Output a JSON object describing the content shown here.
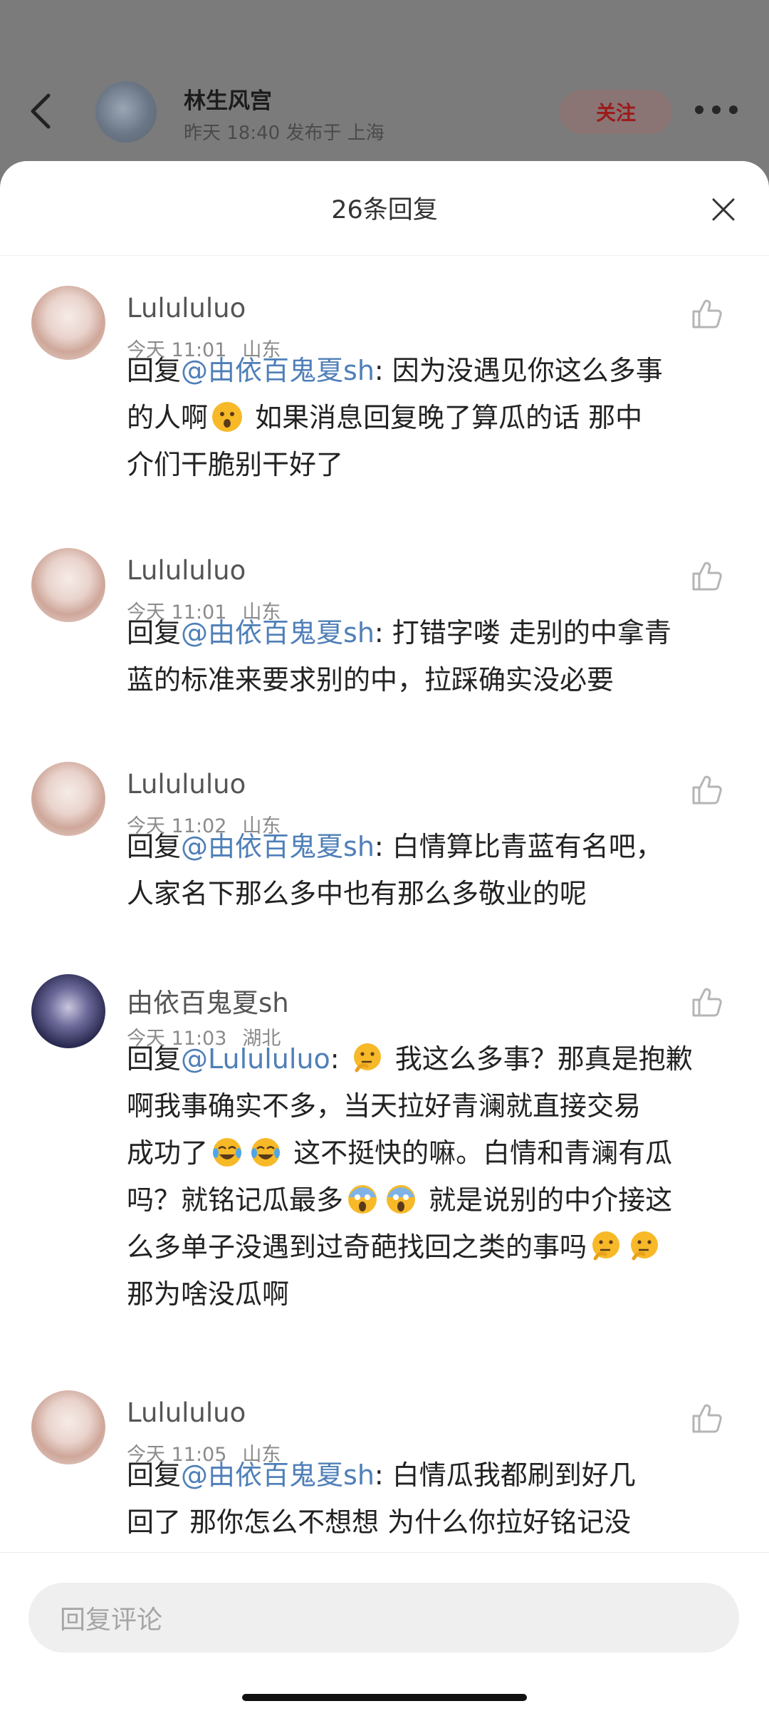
{
  "header": {
    "author_name": "林生风宫",
    "post_meta": "昨天 18:40 发布于 上海",
    "follow_label": "关注"
  },
  "sheet": {
    "title": "26条回复"
  },
  "comments": [
    {
      "name": "Lulululuo",
      "time": "今天 11:01",
      "location": "山东",
      "reply_prefix": "回复",
      "mention": "@由依百鬼夏sh",
      "lines": [
        ": 因为没遇见你这么多事",
        "的人啊",
        " 如果消息回复晚了算瓜的话 那中",
        "介们干脆别干好了"
      ]
    },
    {
      "name": "Lulululuo",
      "time": "今天 11:01",
      "location": "山东",
      "reply_prefix": "回复",
      "mention": "@由依百鬼夏sh",
      "lines": [
        ": 打错字喽 走别的中拿青",
        "蓝的标准来要求别的中，拉踩确实没必要"
      ]
    },
    {
      "name": "Lulululuo",
      "time": "今天 11:02",
      "location": "山东",
      "reply_prefix": "回复",
      "mention": "@由依百鬼夏sh",
      "lines": [
        ": 白情算比青蓝有名吧，",
        "人家名下那么多中也有那么多敬业的呢"
      ]
    },
    {
      "name": "由依百鬼夏sh",
      "time": "今天 11:03",
      "location": "湖北",
      "reply_prefix": "回复",
      "mention": "@Lulululuo",
      "lines": [
        ": ",
        " 我这么多事？那真是抱歉",
        "啊我事确实不多，当天拉好青澜就直接交易",
        "成功了",
        " 这不挺快的嘛。白情和青澜有瓜",
        "吗？就铭记瓜最多",
        " 就是说别的中介接这",
        "么多单子没遇到过奇葩找回之类的事吗",
        "那为啥没瓜啊"
      ]
    },
    {
      "name": "Lulululuo",
      "time": "今天 11:05",
      "location": "山东",
      "reply_prefix": "回复",
      "mention": "@由依百鬼夏sh",
      "lines": [
        ": 白情瓜我都刷到好几",
        "回了 那你怎么不想想 为什么你拉好铭记没"
      ]
    }
  ],
  "input": {
    "placeholder": "回复评论"
  },
  "icons": {
    "back": "back-arrow-icon",
    "more": "more-dots-icon",
    "close": "close-icon",
    "like": "thumbs-up-icon",
    "emoji_surprised": "surprised-face-emoji",
    "emoji_thinking": "thinking-face-emoji",
    "emoji_laughing": "tears-of-joy-emoji",
    "emoji_screaming": "screaming-face-emoji"
  },
  "colors": {
    "mention": "#4f7fb8",
    "follow_text": "#9c1b1b",
    "overlay": "#7b7b7b"
  }
}
